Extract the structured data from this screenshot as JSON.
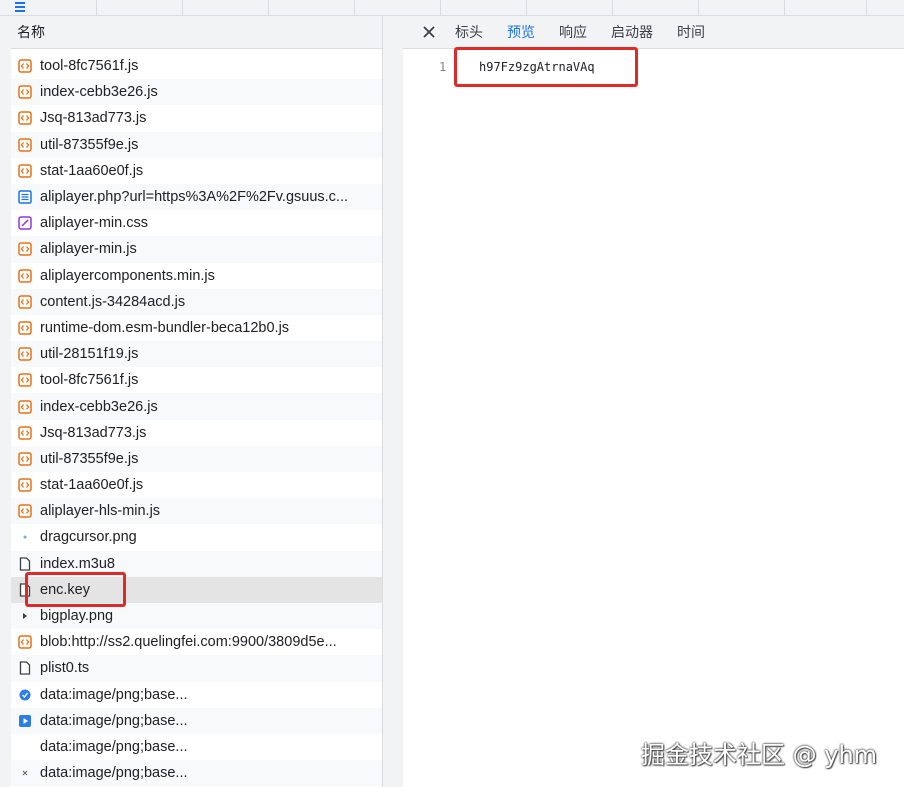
{
  "list": {
    "header": "名称",
    "rows": [
      {
        "name": "tool-8fc7561f.js",
        "icon": "js-file-icon"
      },
      {
        "name": "index-cebb3e26.js",
        "icon": "js-file-icon"
      },
      {
        "name": "Jsq-813ad773.js",
        "icon": "js-file-icon"
      },
      {
        "name": "util-87355f9e.js",
        "icon": "js-file-icon"
      },
      {
        "name": "stat-1aa60e0f.js",
        "icon": "js-file-icon"
      },
      {
        "name": "aliplayer.php?url=https%3A%2F%2Fv.gsuus.c...",
        "icon": "document-icon"
      },
      {
        "name": "aliplayer-min.css",
        "icon": "css-file-icon"
      },
      {
        "name": "aliplayer-min.js",
        "icon": "js-file-icon"
      },
      {
        "name": "aliplayercomponents.min.js",
        "icon": "js-file-icon"
      },
      {
        "name": "content.js-34284acd.js",
        "icon": "js-file-icon"
      },
      {
        "name": "runtime-dom.esm-bundler-beca12b0.js",
        "icon": "js-file-icon"
      },
      {
        "name": "util-28151f19.js",
        "icon": "js-file-icon"
      },
      {
        "name": "tool-8fc7561f.js",
        "icon": "js-file-icon"
      },
      {
        "name": "index-cebb3e26.js",
        "icon": "js-file-icon"
      },
      {
        "name": "Jsq-813ad773.js",
        "icon": "js-file-icon"
      },
      {
        "name": "util-87355f9e.js",
        "icon": "js-file-icon"
      },
      {
        "name": "stat-1aa60e0f.js",
        "icon": "js-file-icon"
      },
      {
        "name": "aliplayer-hls-min.js",
        "icon": "js-file-icon"
      },
      {
        "name": "dragcursor.png",
        "icon": "image-dot-icon"
      },
      {
        "name": "index.m3u8",
        "icon": "file-icon"
      },
      {
        "name": "enc.key",
        "icon": "file-icon",
        "selected": true
      },
      {
        "name": "bigplay.png",
        "icon": "image-arrow-icon"
      },
      {
        "name": "blob:http://ss2.quelingfei.com:9900/3809d5e...",
        "icon": "js-file-icon"
      },
      {
        "name": "plist0.ts",
        "icon": "file-icon"
      },
      {
        "name": "data:image/png;base...",
        "icon": "blue-circle-icon"
      },
      {
        "name": "data:image/png;base...",
        "icon": "blue-play-icon"
      },
      {
        "name": "data:image/png;base...",
        "icon": "blank-icon"
      },
      {
        "name": "data:image/png;base...",
        "icon": "small-x-icon"
      }
    ]
  },
  "panel": {
    "tabs": [
      {
        "label": "标头",
        "active": false
      },
      {
        "label": "预览",
        "active": true
      },
      {
        "label": "响应",
        "active": false
      },
      {
        "label": "启动器",
        "active": false
      },
      {
        "label": "时间",
        "active": false
      }
    ],
    "line_number": "1",
    "content": "h97Fz9zgAtrnaVAq"
  },
  "watermark": "掘金技术社区 @ yhm",
  "colors": {
    "accent": "#1a73e8",
    "highlight_box": "#e02a2a",
    "js_icon": "#e8711a",
    "doc_icon": "#1a73e8",
    "css_icon": "#9334e6"
  }
}
